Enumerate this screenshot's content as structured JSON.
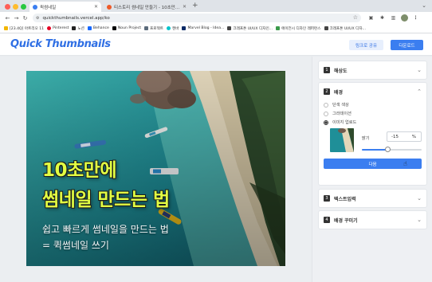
{
  "browser": {
    "tabs": [
      {
        "title": "퀵썸네일",
        "active": true
      },
      {
        "title": "티스토리 썸네일 만들기 - 10초만에 뚝딱...",
        "active": false
      }
    ],
    "new_tab_icon": "plus-icon",
    "url": "quickthumbnails.vercel.app/ko",
    "bookmarks": [
      {
        "label": "[23.4Q] 아트리오 11"
      },
      {
        "label": "Pinterest"
      },
      {
        "label": "노션"
      },
      {
        "label": "Behance"
      },
      {
        "label": "Noun Project"
      },
      {
        "label": "프로젝트"
      },
      {
        "label": "캔바"
      },
      {
        "label": "Marvel Blog - Idea..."
      },
      {
        "label": "크래프톤 UI/UX 디자인..."
      },
      {
        "label": "에이전시 디자인 레퍼런스"
      },
      {
        "label": "크래프톤 UI/UX 디자..."
      }
    ]
  },
  "header": {
    "logo": "Quick Thumbnails",
    "share_label": "링크로 공유",
    "download_label": "다운로드"
  },
  "thumbnail": {
    "title_line1": "10초만에",
    "title_line2": "썸네일 만드는 법",
    "subtitle_line1": "쉽고 빠르게 썸네일을 만드는 법",
    "subtitle_line2": "= 퀵썸네일 쓰기",
    "title_color": "#e2ff43"
  },
  "panel": {
    "sections": [
      {
        "num": "1",
        "title": "해상도",
        "expanded": false
      },
      {
        "num": "2",
        "title": "배경",
        "expanded": true
      },
      {
        "num": "3",
        "title": "텍스트입력",
        "expanded": false
      },
      {
        "num": "4",
        "title": "배경 꾸미기",
        "expanded": false
      }
    ],
    "background": {
      "options": [
        "단색 색상",
        "그라데이션",
        "이미지 업로드"
      ],
      "selected": "이미지 업로드",
      "brightness_label": "밝기",
      "brightness_value": "-15",
      "brightness_unit": "%",
      "slider_level": 0.42,
      "next_label": "다음"
    }
  },
  "colors": {
    "brand": "#2f6fe4",
    "primary_button": "#3b7ef0"
  }
}
